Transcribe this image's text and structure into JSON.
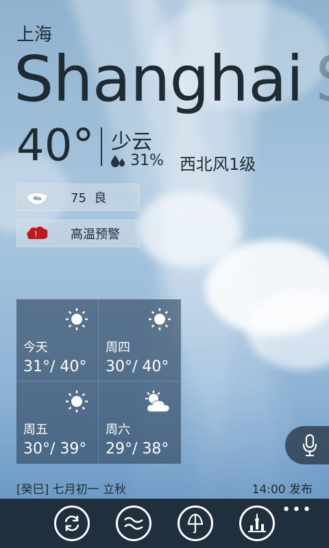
{
  "city": {
    "name_cn": "上海",
    "name_en": "Shanghai",
    "name_en_next": "S"
  },
  "current": {
    "temp": "40°",
    "condition": "少云",
    "humidity": "31%",
    "wind": "西北风1级"
  },
  "aqi": {
    "value": "75",
    "level": "良",
    "icon": "leaf-mask-icon"
  },
  "alert": {
    "label": "高温预警",
    "icon": "heat-warning-icon"
  },
  "forecast": [
    {
      "day": "今天",
      "range": "31°/ 40°",
      "icon": "sun-icon"
    },
    {
      "day": "周四",
      "range": "30°/ 40°",
      "icon": "sun-icon"
    },
    {
      "day": "周五",
      "range": "30°/ 39°",
      "icon": "sun-icon"
    },
    {
      "day": "周六",
      "range": "29°/ 38°",
      "icon": "partly-cloudy-icon"
    }
  ],
  "footer": {
    "lunar": "[癸巳] 七月初一 立秋",
    "published": "14:00 发布"
  },
  "appbar": {
    "buttons": [
      "refresh-icon",
      "wind-icon",
      "umbrella-icon",
      "landmark-icon"
    ],
    "more": "•••"
  },
  "colors": {
    "appbar": "#1f2f3d",
    "alert_red": "#c0171b"
  }
}
